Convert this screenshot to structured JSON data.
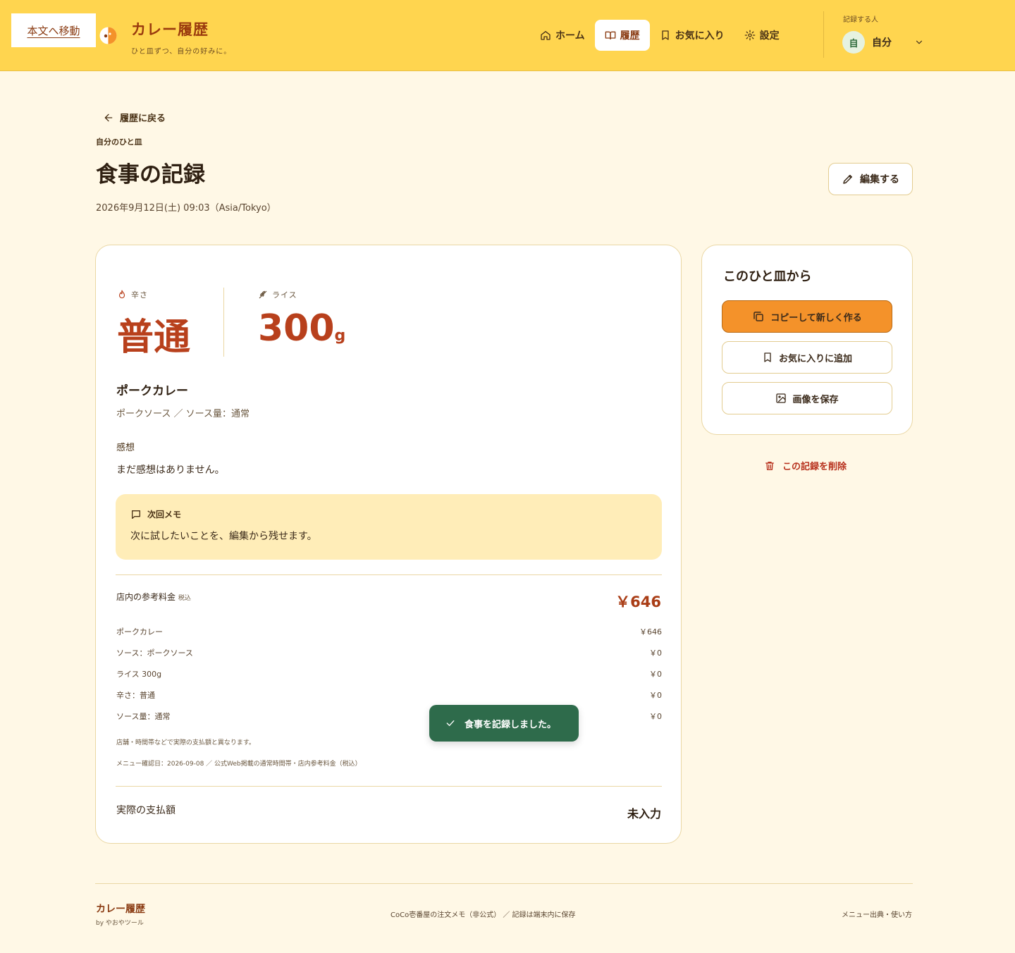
{
  "header": {
    "skip_link": "本文へ移動",
    "brand_title": "カレー履歴",
    "brand_tagline": "ひと皿ずつ、自分の好みに。",
    "nav": [
      {
        "label": "ホーム",
        "icon": "home-icon"
      },
      {
        "label": "履歴",
        "icon": "book-icon"
      },
      {
        "label": "お気に入り",
        "icon": "bookmark-icon"
      },
      {
        "label": "設定",
        "icon": "gear-icon"
      }
    ],
    "active_nav": "履歴",
    "recorder_label": "記録する人",
    "recorder_avatar": "自",
    "recorder_name": "自分"
  },
  "page": {
    "back_label": "履歴に戻る",
    "eyebrow": "自分のひと皿",
    "title": "食事の記録",
    "datetime": "2026年9月12日(土) 09:03（Asia/Tokyo）",
    "edit_label": "編集する"
  },
  "record": {
    "spice_label": "辛さ",
    "spice_value": "普通",
    "rice_label": "ライス",
    "rice_value": "300",
    "rice_unit": "g",
    "menu_name": "ポークカレー",
    "menu_detail": "ポークソース ／ ソース量：通常",
    "impression_label": "感想",
    "impression_text": "まだ感想はありません。",
    "memo_label": "次回メモ",
    "memo_text": "次に試したいことを、編集から残せます。",
    "price_label": "店内の参考料金",
    "price_tax": "税込",
    "price_total": "￥646",
    "price_rows": [
      {
        "name": "ポークカレー",
        "price": "￥646"
      },
      {
        "name": "ソース：ポークソース",
        "price": "￥0"
      },
      {
        "name": "ライス 300g",
        "price": "￥0"
      },
      {
        "name": "辛さ：普通",
        "price": "￥0"
      },
      {
        "name": "ソース量：通常",
        "price": "￥0"
      }
    ],
    "note1": "店舗・時間帯などで実際の支払額と異なります。",
    "note2": "メニュー確認日：2026-09-08 ／ 公式Web掲載の通常時間帯・店内参考料金（税込）",
    "paid_label": "実際の支払額",
    "paid_value": "未入力"
  },
  "side": {
    "title": "このひと皿から",
    "copy_label": "コピーして新しく作る",
    "favorite_label": "お気に入りに追加",
    "save_image_label": "画像を保存",
    "delete_label": "この記録を削除"
  },
  "toast": "食事を記録しました。",
  "footer": {
    "brand": "カレー履歴",
    "by": "by やおやツール",
    "center": "CoCo壱番屋の注文メモ（非公式） ／ 記録は端末内に保存",
    "right": "メニュー出典・使い方"
  },
  "colors": {
    "header_bg": "#ffd54f",
    "page_bg": "#fff8e6",
    "accent": "#f4922a",
    "brand": "#9a3a0e",
    "value": "#b8401c",
    "toast_bg": "#2e6b4b",
    "danger": "#b8321e"
  }
}
